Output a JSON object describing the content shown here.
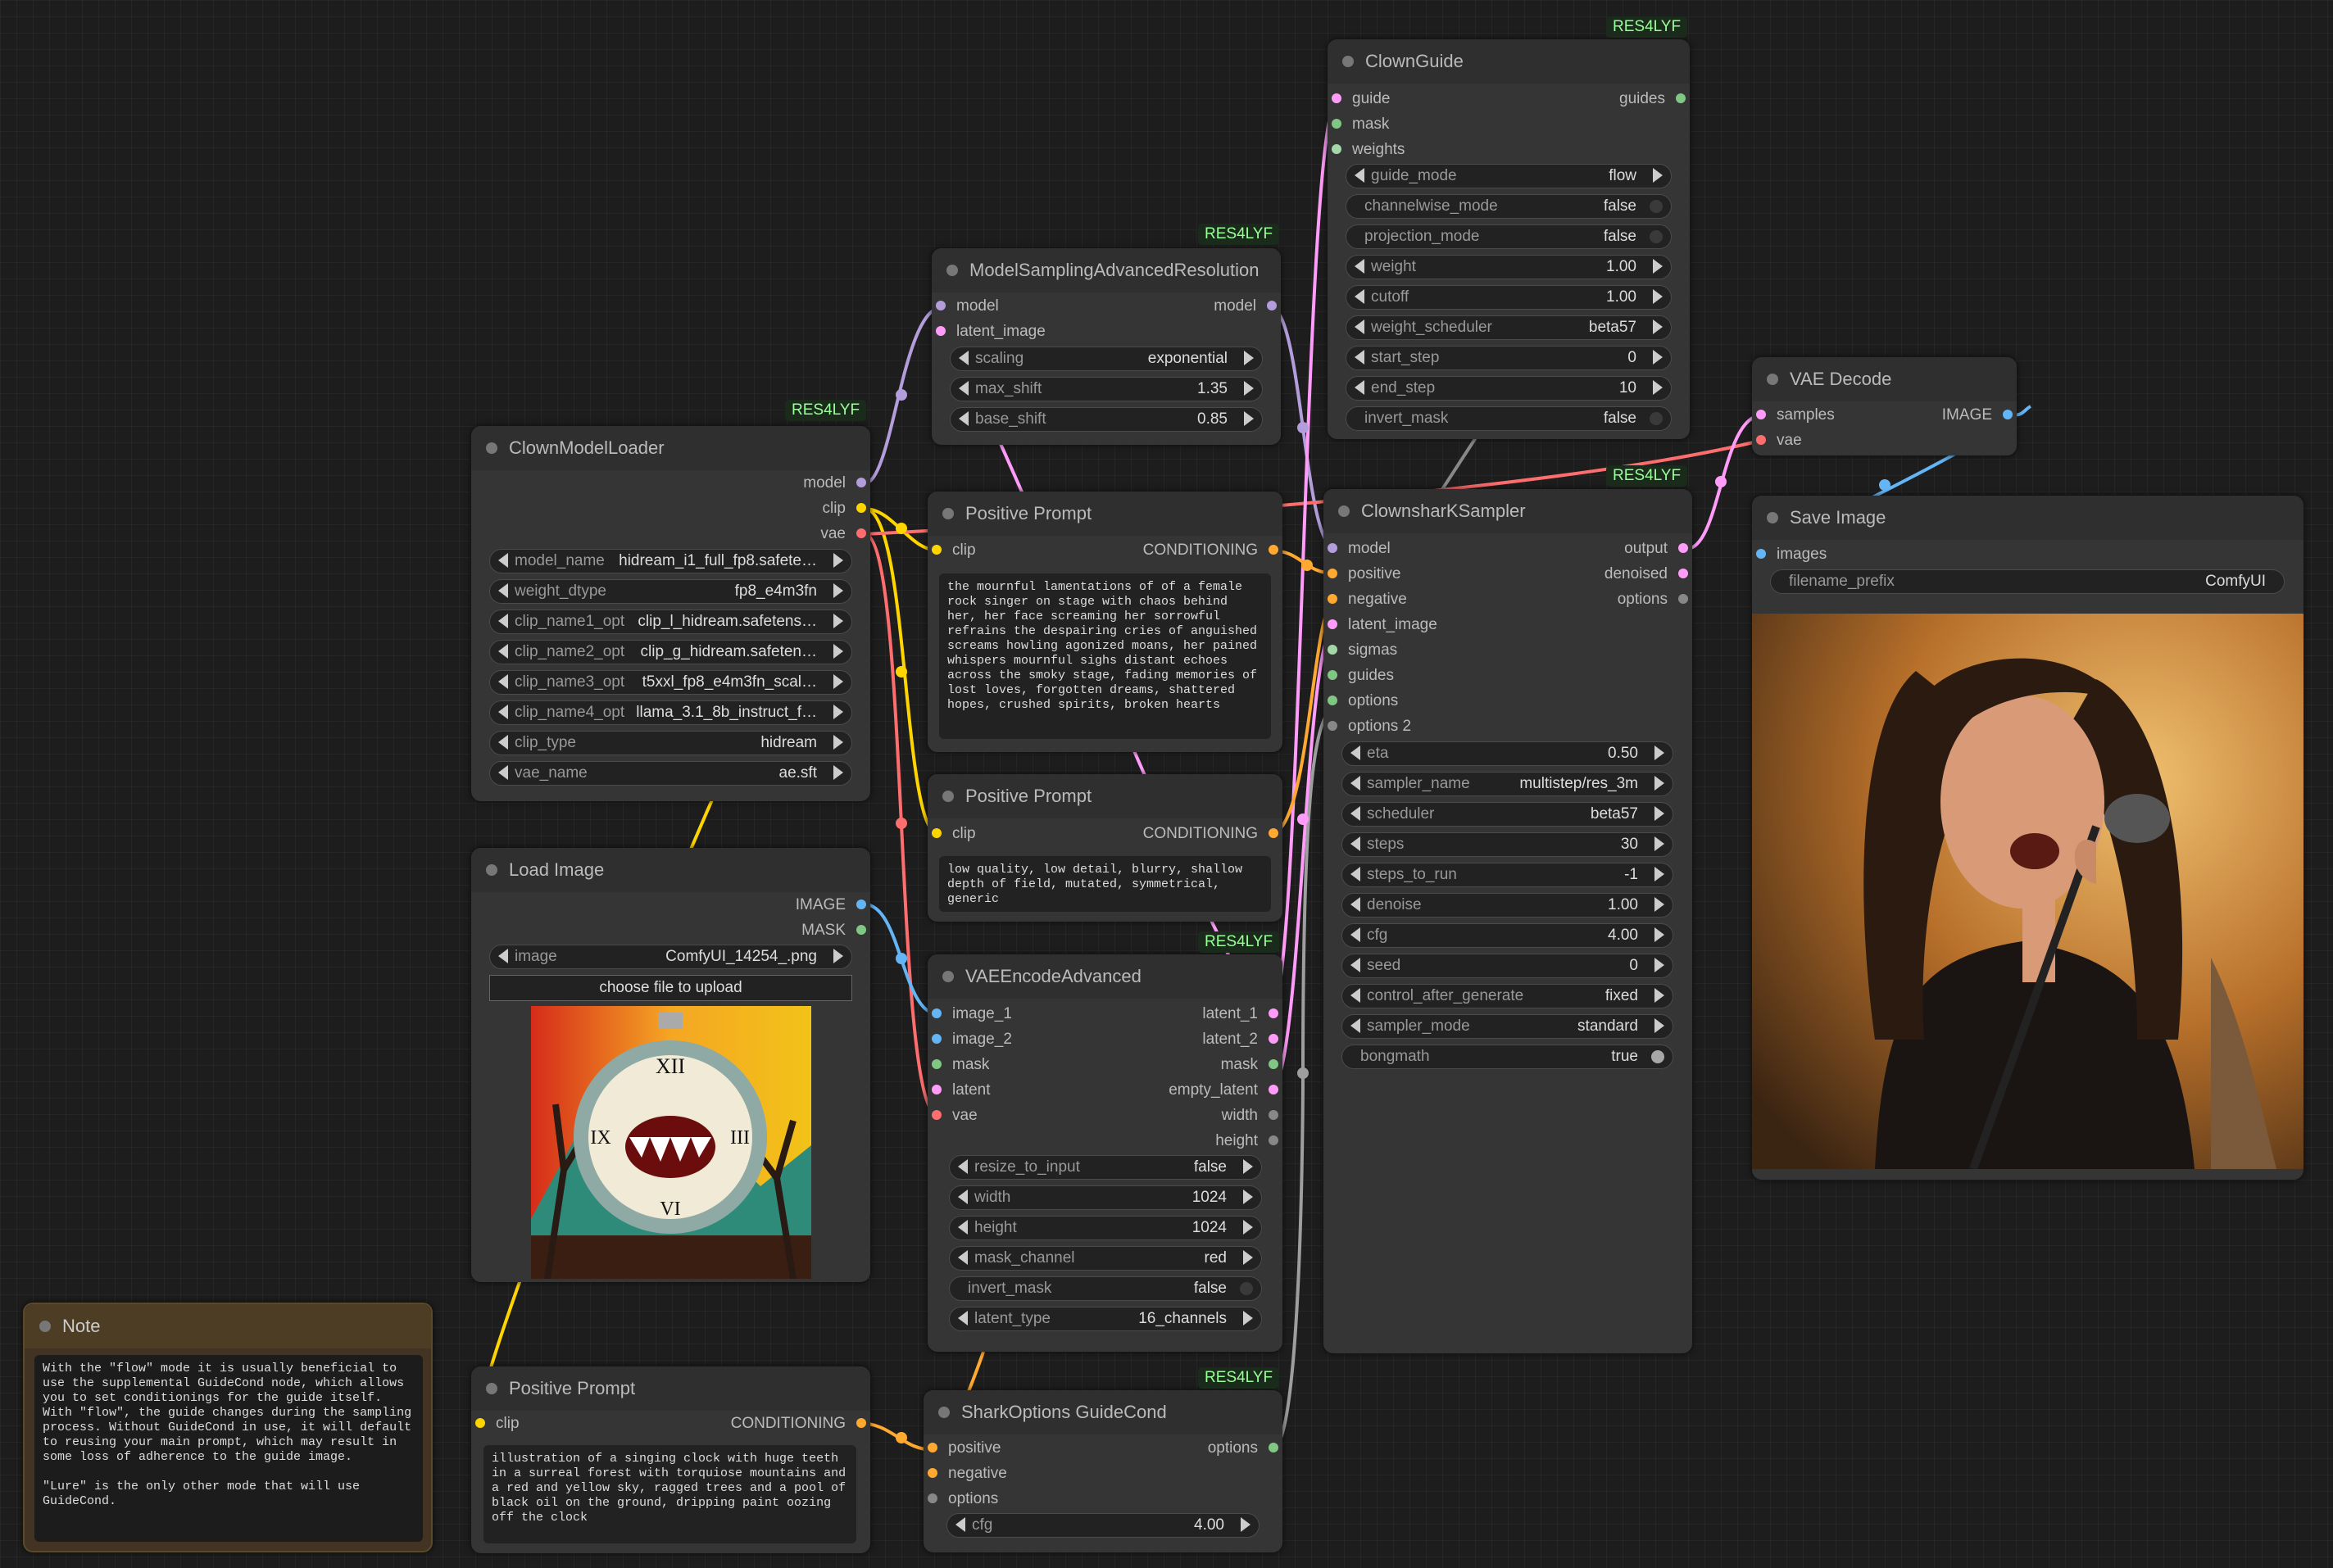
{
  "colors": {
    "background": "#1d1d1d",
    "node": "#353535",
    "model": "#b39ddb",
    "clip": "#ffd500",
    "vae": "#ff6e6e",
    "image": "#64b5f6",
    "mask": "#81c784",
    "latent": "#ff9cf9",
    "conditioning": "#ffa931",
    "options": "#888888"
  },
  "badge": "RES4LYF",
  "clown_model_loader": {
    "title": "ClownModelLoader",
    "outputs": [
      "model",
      "clip",
      "vae"
    ],
    "widgets": [
      {
        "label": "model_name",
        "value": "hidream_i1_full_fp8.safete…"
      },
      {
        "label": "weight_dtype",
        "value": "fp8_e4m3fn"
      },
      {
        "label": "clip_name1_opt",
        "value": "clip_l_hidream.safetens…"
      },
      {
        "label": "clip_name2_opt",
        "value": "clip_g_hidream.safeten…"
      },
      {
        "label": "clip_name3_opt",
        "value": "t5xxl_fp8_e4m3fn_scal…"
      },
      {
        "label": "clip_name4_opt",
        "value": "llama_3.1_8b_instruct_f…"
      },
      {
        "label": "clip_type",
        "value": "hidream"
      },
      {
        "label": "vae_name",
        "value": "ae.sft"
      }
    ]
  },
  "load_image": {
    "title": "Load Image",
    "outputs": [
      "IMAGE",
      "MASK"
    ],
    "widget": {
      "label": "image",
      "value": "ComfyUI_14254_.png"
    },
    "upload_button": "choose file to upload"
  },
  "note": {
    "title": "Note",
    "text": "With the \"flow\" mode it is usually beneficial to use the supplemental GuideCond node, which allows you to set conditionings for the guide itself. With \"flow\", the guide changes during the sampling process. Without GuideCond in use, it will default to reusing your main prompt, which may result in some loss of adherence to the guide image.\n\n\"Lure\" is the only other mode that will use GuideCond."
  },
  "prompt_bottom": {
    "title": "Positive Prompt",
    "input": "clip",
    "output": "CONDITIONING",
    "text": "illustration of a singing clock with huge teeth in a surreal forest with torquiose mountains and a red and yellow sky, ragged trees and a pool of black oil on the ground, dripping paint oozing off the clock"
  },
  "model_sampling": {
    "title": "ModelSamplingAdvancedResolution",
    "inputs": [
      "model",
      "latent_image"
    ],
    "output": "model",
    "widgets": [
      {
        "label": "scaling",
        "value": "exponential"
      },
      {
        "label": "max_shift",
        "value": "1.35"
      },
      {
        "label": "base_shift",
        "value": "0.85"
      }
    ]
  },
  "prompt_pos": {
    "title": "Positive Prompt",
    "input": "clip",
    "output": "CONDITIONING",
    "text": "the mournful lamentations of of a female rock singer on stage with chaos behind her, her face screaming her sorrowful refrains the despairing cries of anguished screams howling agonized moans, her pained whispers mournful sighs distant echoes across the smoky stage, fading memories of lost loves, forgotten dreams, shattered hopes, crushed spirits, broken hearts"
  },
  "prompt_neg": {
    "title": "Positive Prompt",
    "input": "clip",
    "output": "CONDITIONING",
    "text": "low quality, low detail, blurry, shallow depth of field, mutated, symmetrical, generic"
  },
  "vae_encode": {
    "title": "VAEEncodeAdvanced",
    "inputs": [
      "image_1",
      "image_2",
      "mask",
      "latent",
      "vae"
    ],
    "outputs": [
      "latent_1",
      "latent_2",
      "mask",
      "empty_latent",
      "width",
      "height"
    ],
    "widgets": [
      {
        "label": "resize_to_input",
        "value": "false"
      },
      {
        "label": "width",
        "value": "1024"
      },
      {
        "label": "height",
        "value": "1024"
      },
      {
        "label": "mask_channel",
        "value": "red"
      },
      {
        "label": "invert_mask",
        "value": "false"
      },
      {
        "label": "latent_type",
        "value": "16_channels"
      }
    ]
  },
  "shark_options": {
    "title": "SharkOptions GuideCond",
    "inputs": [
      "positive",
      "negative",
      "options"
    ],
    "output": "options",
    "widget": {
      "label": "cfg",
      "value": "4.00"
    }
  },
  "clown_guide": {
    "title": "ClownGuide",
    "inputs": [
      "guide",
      "mask",
      "weights"
    ],
    "output": "guides",
    "widgets": [
      {
        "label": "guide_mode",
        "value": "flow"
      },
      {
        "label": "channelwise_mode",
        "value": "false"
      },
      {
        "label": "projection_mode",
        "value": "false"
      },
      {
        "label": "weight",
        "value": "1.00"
      },
      {
        "label": "cutoff",
        "value": "1.00"
      },
      {
        "label": "weight_scheduler",
        "value": "beta57"
      },
      {
        "label": "start_step",
        "value": "0"
      },
      {
        "label": "end_step",
        "value": "10"
      },
      {
        "label": "invert_mask",
        "value": "false"
      }
    ]
  },
  "ksampler": {
    "title": "ClownsharKSampler",
    "inputs": [
      "model",
      "positive",
      "negative",
      "latent_image",
      "sigmas",
      "guides",
      "options",
      "options 2"
    ],
    "outputs": [
      "output",
      "denoised",
      "options"
    ],
    "widgets": [
      {
        "label": "eta",
        "value": "0.50"
      },
      {
        "label": "sampler_name",
        "value": "multistep/res_3m"
      },
      {
        "label": "scheduler",
        "value": "beta57"
      },
      {
        "label": "steps",
        "value": "30"
      },
      {
        "label": "steps_to_run",
        "value": "-1"
      },
      {
        "label": "denoise",
        "value": "1.00"
      },
      {
        "label": "cfg",
        "value": "4.00"
      },
      {
        "label": "seed",
        "value": "0"
      },
      {
        "label": "control_after_generate",
        "value": "fixed"
      },
      {
        "label": "sampler_mode",
        "value": "standard"
      },
      {
        "label": "bongmath",
        "value": "true"
      }
    ]
  },
  "vae_decode": {
    "title": "VAE Decode",
    "inputs": [
      "samples",
      "vae"
    ],
    "output": "IMAGE"
  },
  "save_image": {
    "title": "Save Image",
    "input": "images",
    "widget": {
      "label": "filename_prefix",
      "value": "ComfyUI"
    }
  }
}
